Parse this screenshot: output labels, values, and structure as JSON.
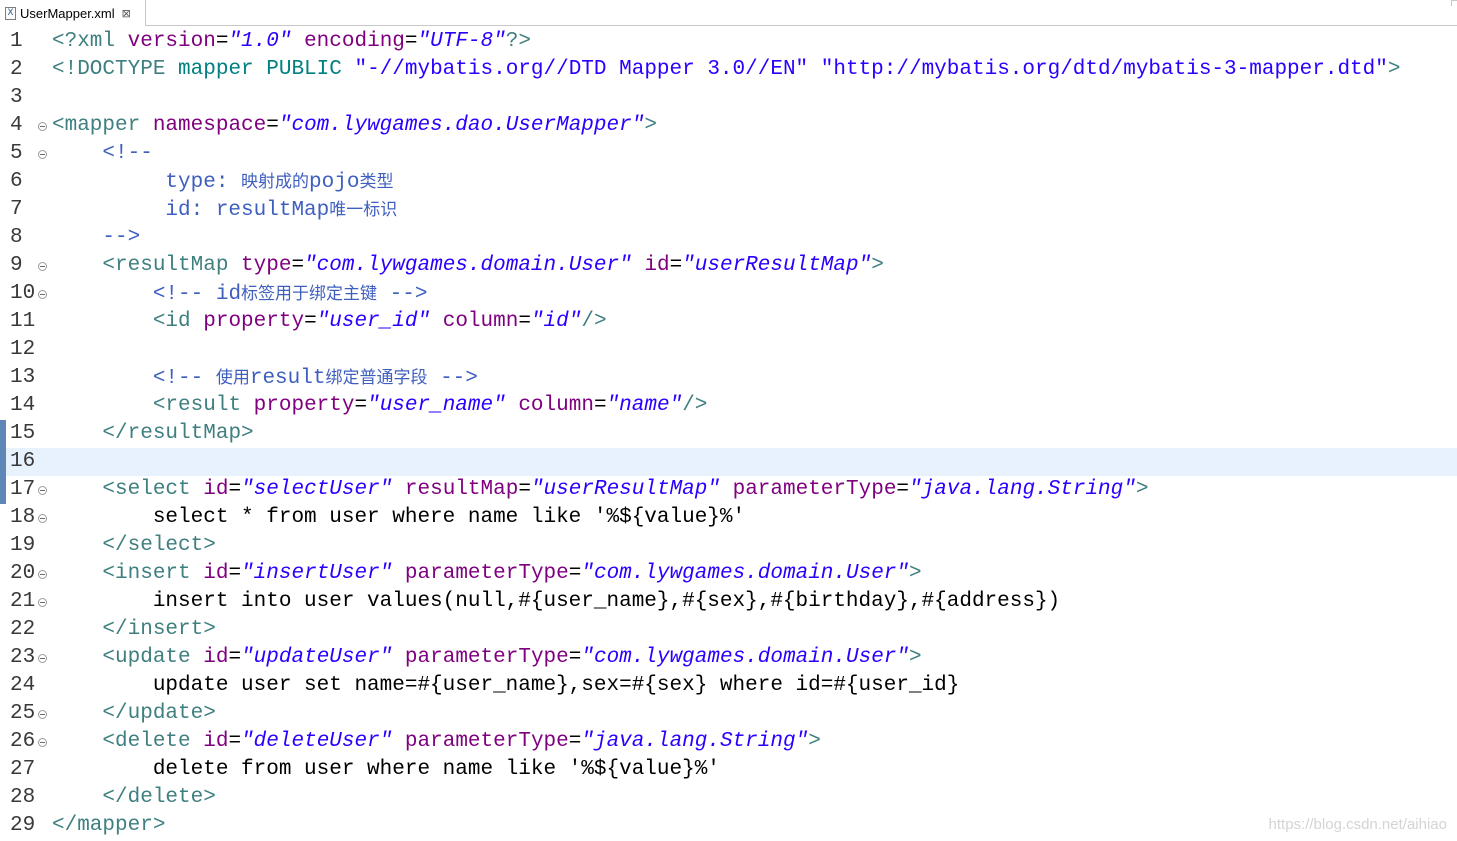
{
  "tab": {
    "icon_glyph": "X",
    "title": "UserMapper.xml",
    "close_glyph": "⊠"
  },
  "current_line": 16,
  "lines": [
    {
      "n": "1",
      "fold": false,
      "marker": false,
      "segs": [
        {
          "k": "tag",
          "t": "<?xml "
        },
        {
          "k": "attr",
          "t": "version"
        },
        {
          "k": "txt",
          "t": "="
        },
        {
          "k": "str",
          "t": "\"1.0\""
        },
        {
          "k": "txt",
          "t": " "
        },
        {
          "k": "attr",
          "t": "encoding"
        },
        {
          "k": "txt",
          "t": "="
        },
        {
          "k": "str",
          "t": "\"UTF-8\""
        },
        {
          "k": "tag",
          "t": "?>"
        }
      ]
    },
    {
      "n": "2",
      "fold": false,
      "marker": false,
      "segs": [
        {
          "k": "tag",
          "t": "<!DOCTYPE "
        },
        {
          "k": "dt",
          "t": "mapper PUBLIC "
        },
        {
          "k": "str_plain",
          "t": "\"-//mybatis.org//DTD Mapper 3.0//EN\""
        },
        {
          "k": "txt",
          "t": " "
        },
        {
          "k": "str_plain",
          "t": "\"http://mybatis.org/dtd/mybatis-3-mapper.dtd\""
        },
        {
          "k": "tag",
          "t": ">"
        }
      ]
    },
    {
      "n": "3",
      "fold": false,
      "marker": false,
      "segs": []
    },
    {
      "n": "4",
      "fold": true,
      "marker": false,
      "segs": [
        {
          "k": "tag",
          "t": "<mapper "
        },
        {
          "k": "attr",
          "t": "namespace"
        },
        {
          "k": "txt",
          "t": "="
        },
        {
          "k": "str",
          "t": "\"com.lywgames.dao.UserMapper\""
        },
        {
          "k": "tag",
          "t": ">"
        }
      ]
    },
    {
      "n": "5",
      "fold": true,
      "marker": false,
      "segs": [
        {
          "k": "txt",
          "t": "    "
        },
        {
          "k": "com",
          "t": "<!--"
        }
      ]
    },
    {
      "n": "6",
      "fold": false,
      "marker": false,
      "segs": [
        {
          "k": "txt",
          "t": "         "
        },
        {
          "k": "com",
          "t": "type: "
        },
        {
          "k": "comcjk",
          "t": "映射成的"
        },
        {
          "k": "com",
          "t": "pojo"
        },
        {
          "k": "comcjk",
          "t": "类型"
        }
      ]
    },
    {
      "n": "7",
      "fold": false,
      "marker": false,
      "segs": [
        {
          "k": "txt",
          "t": "         "
        },
        {
          "k": "com",
          "t": "id: resultMap"
        },
        {
          "k": "comcjk",
          "t": "唯一标识"
        }
      ]
    },
    {
      "n": "8",
      "fold": false,
      "marker": false,
      "segs": [
        {
          "k": "txt",
          "t": "    "
        },
        {
          "k": "com",
          "t": "-->"
        }
      ]
    },
    {
      "n": "9",
      "fold": true,
      "marker": false,
      "segs": [
        {
          "k": "txt",
          "t": "    "
        },
        {
          "k": "tag",
          "t": "<resultMap "
        },
        {
          "k": "attr",
          "t": "type"
        },
        {
          "k": "txt",
          "t": "="
        },
        {
          "k": "str",
          "t": "\"com.lywgames.domain.User\""
        },
        {
          "k": "txt",
          "t": " "
        },
        {
          "k": "attr",
          "t": "id"
        },
        {
          "k": "txt",
          "t": "="
        },
        {
          "k": "str",
          "t": "\"userResultMap\""
        },
        {
          "k": "tag",
          "t": ">"
        }
      ]
    },
    {
      "n": "10",
      "fold": true,
      "marker": false,
      "segs": [
        {
          "k": "txt",
          "t": "        "
        },
        {
          "k": "com",
          "t": "<!-- id"
        },
        {
          "k": "comcjk",
          "t": "标签用于绑定主键"
        },
        {
          "k": "com",
          "t": " -->"
        }
      ]
    },
    {
      "n": "11",
      "fold": false,
      "marker": false,
      "segs": [
        {
          "k": "txt",
          "t": "        "
        },
        {
          "k": "tag",
          "t": "<id "
        },
        {
          "k": "attr",
          "t": "property"
        },
        {
          "k": "txt",
          "t": "="
        },
        {
          "k": "str",
          "t": "\"user_id\""
        },
        {
          "k": "txt",
          "t": " "
        },
        {
          "k": "attr",
          "t": "column"
        },
        {
          "k": "txt",
          "t": "="
        },
        {
          "k": "str",
          "t": "\"id\""
        },
        {
          "k": "tag",
          "t": "/>"
        }
      ]
    },
    {
      "n": "12",
      "fold": false,
      "marker": false,
      "segs": []
    },
    {
      "n": "13",
      "fold": false,
      "marker": false,
      "segs": [
        {
          "k": "txt",
          "t": "        "
        },
        {
          "k": "com",
          "t": "<!-- "
        },
        {
          "k": "comcjk",
          "t": "使用"
        },
        {
          "k": "com",
          "t": "result"
        },
        {
          "k": "comcjk",
          "t": "绑定普通字段"
        },
        {
          "k": "com",
          "t": " -->"
        }
      ]
    },
    {
      "n": "14",
      "fold": false,
      "marker": false,
      "segs": [
        {
          "k": "txt",
          "t": "        "
        },
        {
          "k": "tag",
          "t": "<result "
        },
        {
          "k": "attr",
          "t": "property"
        },
        {
          "k": "txt",
          "t": "="
        },
        {
          "k": "str",
          "t": "\"user_name\""
        },
        {
          "k": "txt",
          "t": " "
        },
        {
          "k": "attr",
          "t": "column"
        },
        {
          "k": "txt",
          "t": "="
        },
        {
          "k": "str",
          "t": "\"name\""
        },
        {
          "k": "tag",
          "t": "/>"
        }
      ]
    },
    {
      "n": "15",
      "fold": false,
      "marker": true,
      "segs": [
        {
          "k": "txt",
          "t": "    "
        },
        {
          "k": "tag",
          "t": "</resultMap>"
        }
      ]
    },
    {
      "n": "16",
      "fold": false,
      "marker": true,
      "segs": []
    },
    {
      "n": "17",
      "fold": true,
      "marker": true,
      "segs": [
        {
          "k": "txt",
          "t": "    "
        },
        {
          "k": "tag",
          "t": "<select "
        },
        {
          "k": "attr",
          "t": "id"
        },
        {
          "k": "txt",
          "t": "="
        },
        {
          "k": "str",
          "t": "\"selectUser\""
        },
        {
          "k": "txt",
          "t": " "
        },
        {
          "k": "attr",
          "t": "resultMap"
        },
        {
          "k": "txt",
          "t": "="
        },
        {
          "k": "str",
          "t": "\"userResultMap\""
        },
        {
          "k": "txt",
          "t": " "
        },
        {
          "k": "attr",
          "t": "parameterType"
        },
        {
          "k": "txt",
          "t": "="
        },
        {
          "k": "str",
          "t": "\"java.lang.String\""
        },
        {
          "k": "tag",
          "t": ">"
        }
      ]
    },
    {
      "n": "18",
      "fold": true,
      "marker": false,
      "segs": [
        {
          "k": "txt",
          "t": "        select * from user where name like '%${value}%'"
        }
      ]
    },
    {
      "n": "19",
      "fold": false,
      "marker": false,
      "segs": [
        {
          "k": "txt",
          "t": "    "
        },
        {
          "k": "tag",
          "t": "</select>"
        }
      ]
    },
    {
      "n": "20",
      "fold": true,
      "marker": false,
      "segs": [
        {
          "k": "txt",
          "t": "    "
        },
        {
          "k": "tag",
          "t": "<insert "
        },
        {
          "k": "attr",
          "t": "id"
        },
        {
          "k": "txt",
          "t": "="
        },
        {
          "k": "str",
          "t": "\"insertUser\""
        },
        {
          "k": "txt",
          "t": " "
        },
        {
          "k": "attr",
          "t": "parameterType"
        },
        {
          "k": "txt",
          "t": "="
        },
        {
          "k": "str",
          "t": "\"com.lywgames.domain.User\""
        },
        {
          "k": "tag",
          "t": ">"
        }
      ]
    },
    {
      "n": "21",
      "fold": true,
      "marker": false,
      "segs": [
        {
          "k": "txt",
          "t": "        insert into user values(null,#{user_name},#{sex},#{birthday},#{address})"
        }
      ]
    },
    {
      "n": "22",
      "fold": false,
      "marker": false,
      "segs": [
        {
          "k": "txt",
          "t": "    "
        },
        {
          "k": "tag",
          "t": "</insert>"
        }
      ]
    },
    {
      "n": "23",
      "fold": true,
      "marker": false,
      "segs": [
        {
          "k": "txt",
          "t": "    "
        },
        {
          "k": "tag",
          "t": "<update "
        },
        {
          "k": "attr",
          "t": "id"
        },
        {
          "k": "txt",
          "t": "="
        },
        {
          "k": "str",
          "t": "\"updateUser\""
        },
        {
          "k": "txt",
          "t": " "
        },
        {
          "k": "attr",
          "t": "parameterType"
        },
        {
          "k": "txt",
          "t": "="
        },
        {
          "k": "str",
          "t": "\"com.lywgames.domain.User\""
        },
        {
          "k": "tag",
          "t": ">"
        }
      ]
    },
    {
      "n": "24",
      "fold": false,
      "marker": false,
      "segs": [
        {
          "k": "txt",
          "t": "        update user set name=#{user_name},sex=#{sex} where id=#{user_id}"
        }
      ]
    },
    {
      "n": "25",
      "fold": true,
      "marker": false,
      "segs": [
        {
          "k": "txt",
          "t": "    "
        },
        {
          "k": "tag",
          "t": "</update>"
        }
      ]
    },
    {
      "n": "26",
      "fold": true,
      "marker": false,
      "segs": [
        {
          "k": "txt",
          "t": "    "
        },
        {
          "k": "tag",
          "t": "<delete "
        },
        {
          "k": "attr",
          "t": "id"
        },
        {
          "k": "txt",
          "t": "="
        },
        {
          "k": "str",
          "t": "\"deleteUser\""
        },
        {
          "k": "txt",
          "t": " "
        },
        {
          "k": "attr",
          "t": "parameterType"
        },
        {
          "k": "txt",
          "t": "="
        },
        {
          "k": "str",
          "t": "\"java.lang.String\""
        },
        {
          "k": "tag",
          "t": ">"
        }
      ]
    },
    {
      "n": "27",
      "fold": false,
      "marker": false,
      "segs": [
        {
          "k": "txt",
          "t": "        delete from user where name like '%${value}%'"
        }
      ]
    },
    {
      "n": "28",
      "fold": false,
      "marker": false,
      "segs": [
        {
          "k": "txt",
          "t": "    "
        },
        {
          "k": "tag",
          "t": "</delete>"
        }
      ]
    },
    {
      "n": "29",
      "fold": false,
      "marker": false,
      "segs": [
        {
          "k": "tag",
          "t": "</mapper>"
        }
      ]
    }
  ],
  "watermark": "https://blog.csdn.net/aihiao"
}
